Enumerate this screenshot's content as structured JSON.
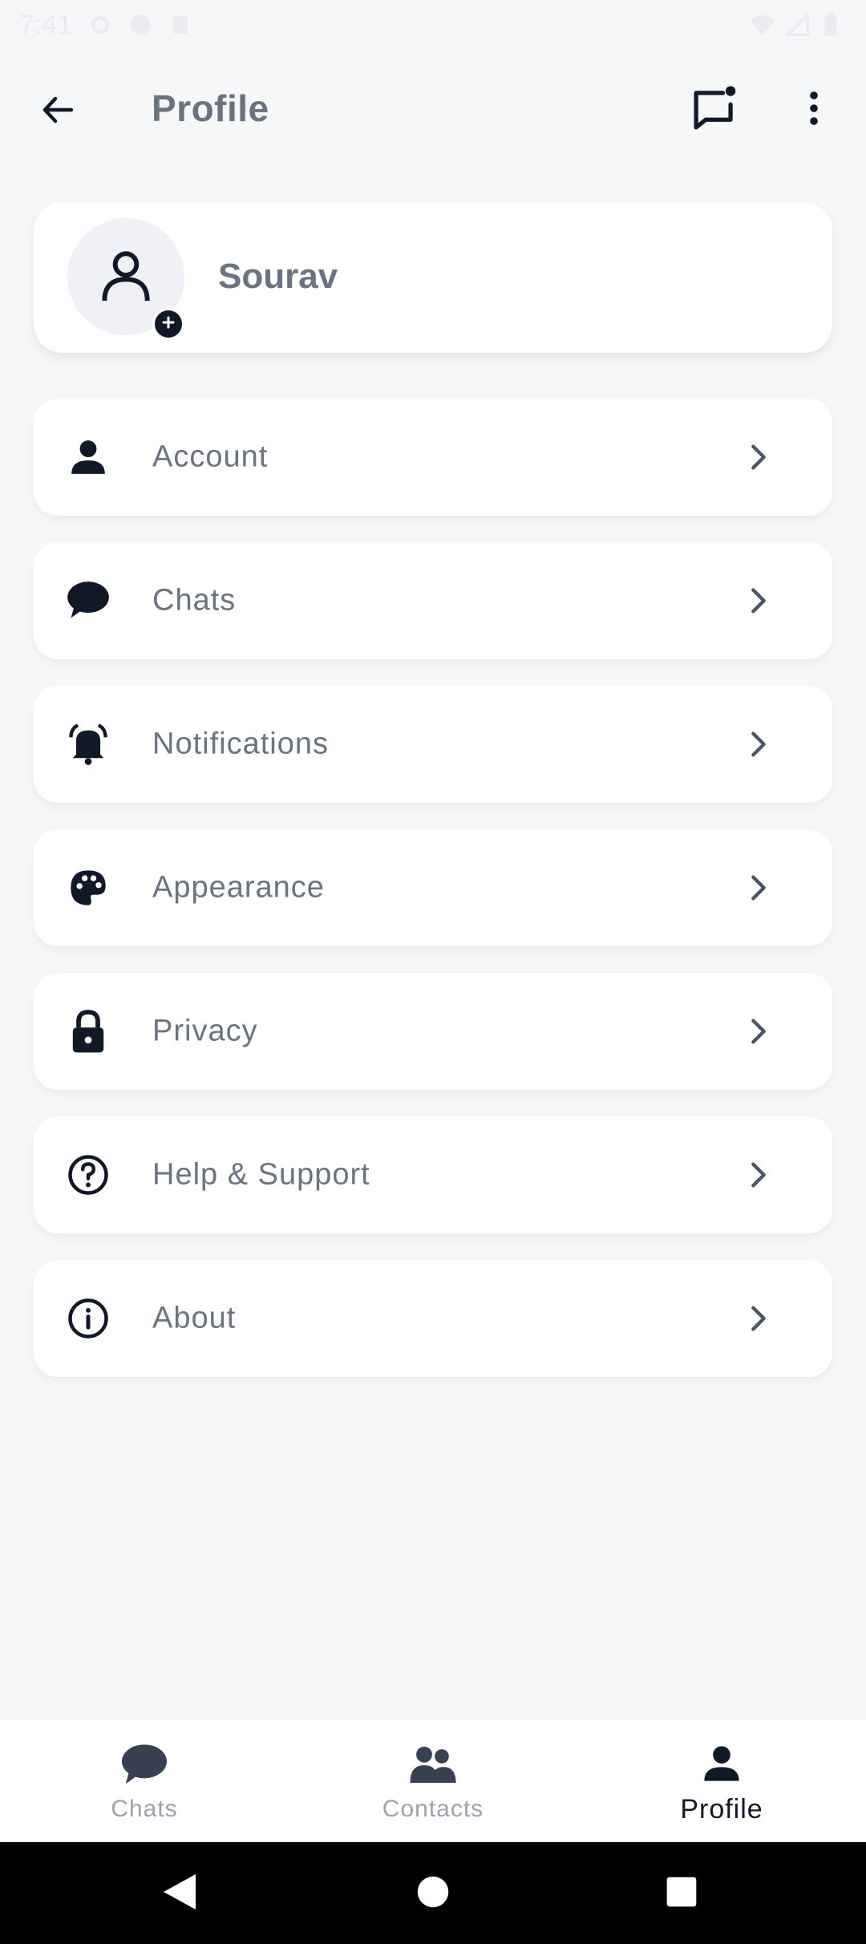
{
  "status_bar": {
    "time": "7:41"
  },
  "header": {
    "title": "Profile"
  },
  "profile": {
    "name": "Sourav"
  },
  "menu": [
    {
      "label": "Account",
      "icon": "person-icon"
    },
    {
      "label": "Chats",
      "icon": "chat-bubble-icon"
    },
    {
      "label": "Notifications",
      "icon": "bell-icon"
    },
    {
      "label": "Appearance",
      "icon": "palette-icon"
    },
    {
      "label": "Privacy",
      "icon": "lock-icon"
    },
    {
      "label": "Help & Support",
      "icon": "help-circle-icon"
    },
    {
      "label": "About",
      "icon": "info-icon"
    }
  ],
  "bottom_nav": {
    "items": [
      {
        "label": "Chats",
        "icon": "chat-bubble-icon",
        "active": false
      },
      {
        "label": "Contacts",
        "icon": "contacts-icon",
        "active": false
      },
      {
        "label": "Profile",
        "icon": "person-icon",
        "active": true
      }
    ]
  },
  "colors": {
    "background": "#F6F7F9",
    "card": "#FFFFFF",
    "text_muted": "#6B7280",
    "icon_dark": "#111827",
    "nav_inactive": "#9CA3AF"
  }
}
